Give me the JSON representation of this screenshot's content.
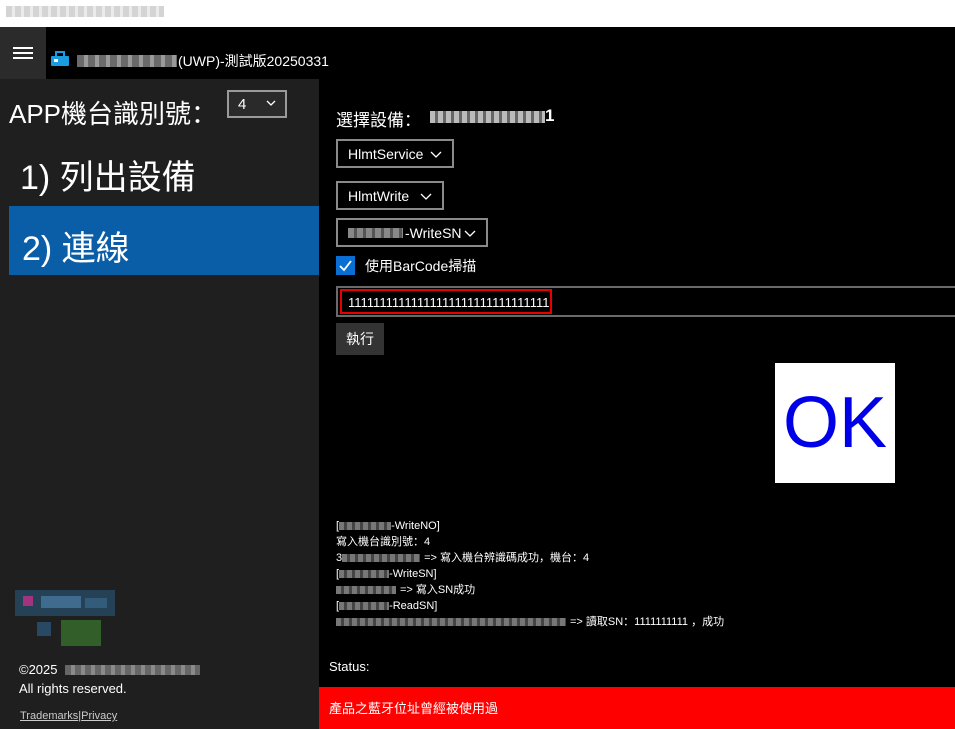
{
  "window": {
    "title": "(UWP)-測試版20250331"
  },
  "sidebar": {
    "app_id_label": "APP機台識別號：",
    "app_id_value": "4",
    "nav_items": [
      {
        "label": "1) 列出設備",
        "selected": false
      },
      {
        "label": "2) 連線",
        "selected": true
      }
    ],
    "copyright_line1": "©2025",
    "copyright_line2": "All rights reserved.",
    "links": {
      "trademarks": "Trademarks",
      "separator": "|",
      "privacy": "Privacy"
    }
  },
  "main": {
    "device_label": "選擇設備：",
    "device_name_tail": "1",
    "service_select": "HlmtService",
    "characteristic_select": "HlmtWrite",
    "command_select": "-WriteSN",
    "use_barcode_label": "使用BarCode掃描",
    "use_barcode_checked": true,
    "barcode_value": "11111111111111111111111111111111",
    "execute_label": "執行",
    "ok_text": "OK",
    "log_lines": [
      {
        "prefix": "[",
        "text": "-WriteNO]"
      },
      {
        "prefix": "",
        "text": "寫入機台識別號：4"
      },
      {
        "prefix": "3",
        "text": "=> 寫入機台辨識碼成功，機台：4"
      },
      {
        "prefix": "[",
        "text": "-WriteSN]"
      },
      {
        "prefix": "",
        "text": "=> 寫入SN成功"
      },
      {
        "prefix": "[",
        "text": "-ReadSN]"
      },
      {
        "prefix": "",
        "text": "=> 讀取SN：1111111111 ，成功"
      }
    ],
    "status_label": "Status:",
    "error_message": "產品之藍牙位址曾經被使用過"
  },
  "colors": {
    "nav_selected": "#0a5da7",
    "error_bar": "#ff0000",
    "ok_text": "#0000e8",
    "checkbox": "#0a6fd2",
    "focus_border": "#e60000"
  }
}
